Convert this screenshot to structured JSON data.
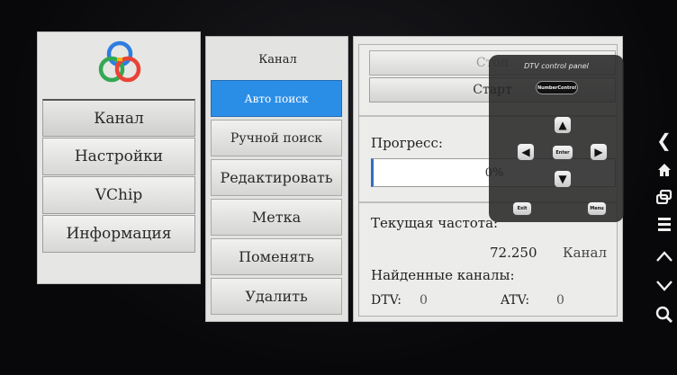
{
  "left_menu": {
    "items": [
      {
        "label": "Канал"
      },
      {
        "label": "Настройки"
      },
      {
        "label": "VChip"
      },
      {
        "label": "Информация"
      }
    ]
  },
  "sub_menu": {
    "title": "Канал",
    "items": [
      {
        "label": "Авто поиск"
      },
      {
        "label": "Ручной поиск"
      },
      {
        "label": "Редактировать"
      },
      {
        "label": "Метка"
      },
      {
        "label": "Поменять"
      },
      {
        "label": "Удалить"
      }
    ]
  },
  "content": {
    "stop_label": "Стоп",
    "start_label": "Старт",
    "progress_label": "Прогресс:",
    "progress_value": "0%",
    "progress_fraction": 0,
    "freq_label": "Текущая частота:",
    "freq_value": "72.250",
    "channel_label": "Канал",
    "found_label": "Найденные каналы:",
    "dtv_label": "DTV:",
    "dtv_count": "0",
    "atv_label": "ATV:",
    "atv_count": "0"
  },
  "dtv_panel": {
    "title": "DTV control panel",
    "number_control": "NumberControl",
    "enter": "Enter",
    "exit": "Exit",
    "menu": "Menu"
  },
  "toolbar": {
    "icons": [
      "back-icon",
      "home-icon",
      "window-icon",
      "menu-icon",
      "volume-up-icon",
      "volume-down-icon",
      "search-icon"
    ]
  }
}
